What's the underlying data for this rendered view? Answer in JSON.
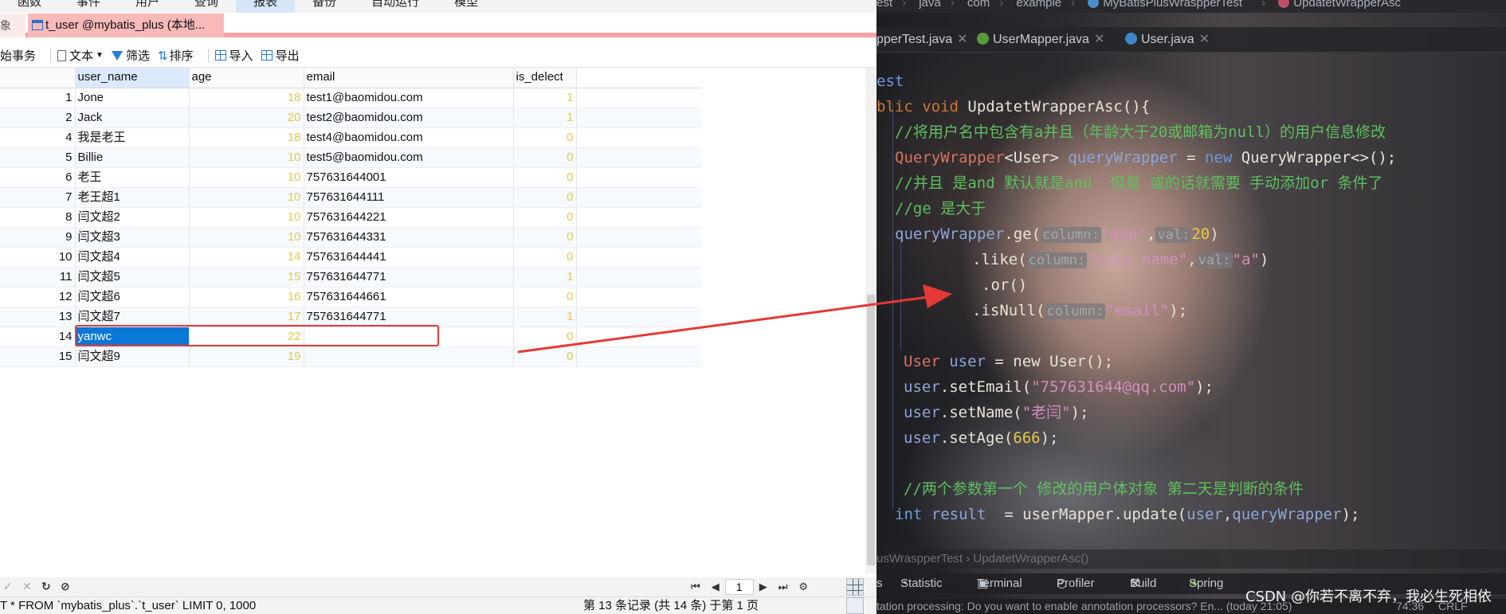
{
  "db": {
    "menu": [
      "函数",
      "事件",
      "用户",
      "查询",
      "报表",
      "备份",
      "自动运行",
      "模型"
    ],
    "menu_active": 4,
    "tab_prev_label": "象",
    "tab_label": "t_user @mybatis_plus (本地...",
    "toolbar": {
      "transaction": "始事务",
      "text": "文本",
      "filter": "筛选",
      "sort": "排序",
      "import": "导入",
      "export": "导出"
    },
    "columns": [
      "user_name",
      "age",
      "email",
      "is_delect"
    ],
    "rows": [
      {
        "idx": "1",
        "user_name": "Jone",
        "age": "18",
        "email": "test1@baomidou.com",
        "is_delect": "1"
      },
      {
        "idx": "2",
        "user_name": "Jack",
        "age": "20",
        "email": "test2@baomidou.com",
        "is_delect": "1"
      },
      {
        "idx": "4",
        "user_name": "我是老王",
        "age": "18",
        "email": "test4@baomidou.com",
        "is_delect": "0"
      },
      {
        "idx": "5",
        "user_name": "Billie",
        "age": "10",
        "email": "test5@baomidou.com",
        "is_delect": "0"
      },
      {
        "idx": "6",
        "user_name": "老王",
        "age": "10",
        "email": "757631644001",
        "is_delect": "0"
      },
      {
        "idx": "7",
        "user_name": "老王超1",
        "age": "10",
        "email": "757631644111",
        "is_delect": "0"
      },
      {
        "idx": "8",
        "user_name": "闫文超2",
        "age": "10",
        "email": "757631644221",
        "is_delect": "0"
      },
      {
        "idx": "9",
        "user_name": "闫文超3",
        "age": "10",
        "email": "757631644331",
        "is_delect": "0"
      },
      {
        "idx": "10",
        "user_name": "闫文超4",
        "age": "14",
        "email": "757631644441",
        "is_delect": "0"
      },
      {
        "idx": "11",
        "user_name": "闫文超5",
        "age": "15",
        "email": "757631644771",
        "is_delect": "1"
      },
      {
        "idx": "12",
        "user_name": "闫文超6",
        "age": "16",
        "email": "757631644661",
        "is_delect": "0"
      },
      {
        "idx": "13",
        "user_name": "闫文超7",
        "age": "17",
        "email": "757631644771",
        "is_delect": "1"
      },
      {
        "idx": "14",
        "user_name": "yanwc",
        "age": "22",
        "email": "",
        "is_delect": "0"
      },
      {
        "idx": "15",
        "user_name": "闫文超9",
        "age": "19",
        "email": "",
        "is_delect": "0"
      }
    ],
    "selected_row": 12,
    "page_number": "1",
    "sql": "T * FROM `mybatis_plus`.`t_user` LIMIT 0, 1000",
    "record_info": "第 13 条记录 (共 14 条) 于第 1 页"
  },
  "ide": {
    "breadcrumb": [
      "est",
      "java",
      "com",
      "example",
      "MyBatisPlusWraspperTest",
      "UpdatetWrapperAsc"
    ],
    "tabs": [
      {
        "label": "pperTest.java"
      },
      {
        "label": "UserMapper.java"
      },
      {
        "label": "User.java"
      }
    ],
    "code": {
      "l1": "est",
      "l2_kw": "blic void ",
      "l2_fn": "UpdatetWrapperAsc(){",
      "l3": "//将用户名中包含有a并且（年龄大于20或邮箱为null）的用户信息修改",
      "l4_type": "QueryWrapper",
      "l4_generic": "<User> ",
      "l4_var": "queryWrapper",
      "l4_eq": " = ",
      "l4_new": "new ",
      "l4_rest": "QueryWrapper<>();",
      "l5": "//并且 是and 默认就是and  但是 或的话就需要 手动添加or 条件了",
      "l6": "//ge 是大于",
      "l7_var": "queryWrapper",
      "l7_call": ".ge(",
      "hint_column": "column:",
      "l7_str": "\"age\"",
      "hint_val": "val:",
      "l7_num": "20",
      "l8_call": ".like(",
      "l8_str": "\"user_name\"",
      "l8_str2": "\"a\"",
      "l9": ".or()",
      "l10_call": ".isNull(",
      "l10_str": "\"email\"",
      "l11_type": "User ",
      "l11_var": "user",
      "l11_rest": " = new User();",
      "l12_call": ".setEmail(",
      "l12_str": "\"757631644@qq.com\"",
      "l13_call": ".setName(",
      "l13_str": "\"老闫\"",
      "l14_call": ".setAge(",
      "l14_num": "666",
      "l15": "//两个参数第一个 修改的用户体对象 第二天是判断的条件",
      "l16_kw": "int ",
      "l16_var": "result",
      "l16_mid": "  = userMapper.update(",
      "l16_a1": "user",
      "l16_a2": "queryWrapper",
      "l16_end": ");"
    },
    "bottom_crumb": "usWraspperTest  ›  UpdatetWrapperAsc()",
    "tools": [
      "s",
      "Statistic",
      "Terminal",
      "Profiler",
      "Build",
      "Spring"
    ],
    "message": "tation processing: Do you want to enable annotation processors? En... (today 21:05)",
    "cursor_pos": "74:36",
    "line_sep": "CRLF",
    "watermark": "CSDN @你若不离不弃，我必生死相依"
  },
  "colors": {
    "selection": "#0a78d7",
    "highlight_box": "#e53935",
    "arrow": "#e53935"
  }
}
